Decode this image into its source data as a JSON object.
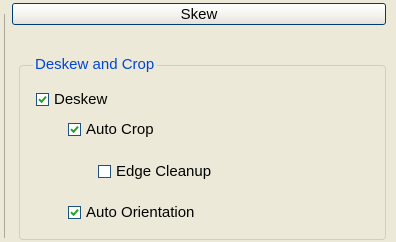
{
  "header": {
    "label": "Skew"
  },
  "group": {
    "title": "Deskew and Crop",
    "items": [
      {
        "label": "Deskew",
        "checked": true
      },
      {
        "label": "Auto Crop",
        "checked": true
      },
      {
        "label": "Edge Cleanup",
        "checked": false
      },
      {
        "label": "Auto Orientation",
        "checked": true
      }
    ]
  },
  "colors": {
    "legend_text": "#0046d5",
    "check_mark": "#21a121",
    "checkbox_border": "#1c5180"
  }
}
